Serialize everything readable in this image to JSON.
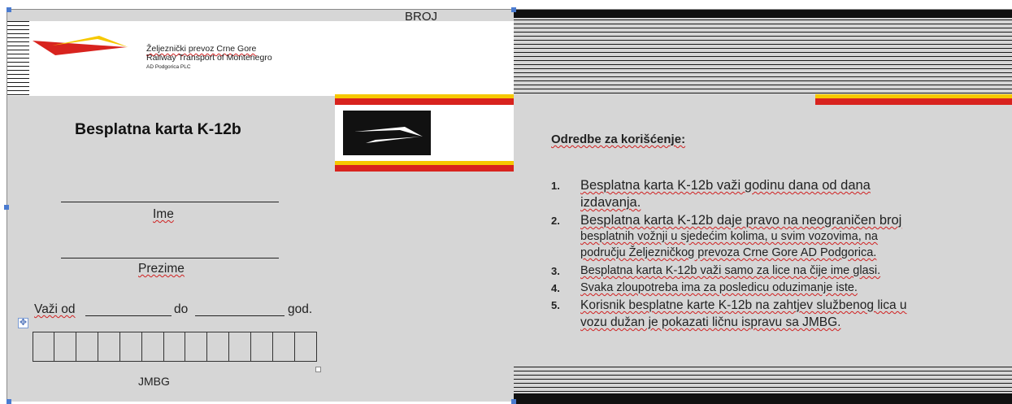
{
  "header": {
    "company_line1": "Željeznički prevoz Crne Gore",
    "company_line2": "Railway Transport of Montenegro",
    "company_line3": "AD Podgorica  PLC",
    "broj": "BROJ"
  },
  "card": {
    "title": "Besplatna karta  K-12b",
    "ime_label": "Ime",
    "prezime_label": "Prezime",
    "vazi_od": "Važi od",
    "do": "do",
    "god": "god.",
    "jmbg_label": "JMBG"
  },
  "rules": {
    "heading": "Odredbe  za  korišćenje:",
    "items": [
      {
        "num": "1.",
        "lines": [
          "Besplatna karta K-12b važi godinu dana od dana",
          "izdavanja."
        ]
      },
      {
        "num": "2.",
        "lines": [
          "Besplatna karta K-12b daje pravo na neograničen broj",
          "besplatnih vožnji u sjedećim kolima, u svim vozovima, na",
          "području  Željezničkog prevoza Crne  Gore AD Podgorica."
        ]
      },
      {
        "num": "3.",
        "lines": [
          "Besplatna karta K-12b važi samo za lice na čije ime glasi."
        ]
      },
      {
        "num": "4.",
        "lines": [
          "Svaka zloupotreba ima za posledicu oduzimanje iste."
        ]
      },
      {
        "num": "5.",
        "lines": [
          "Korisnik besplatne karte K-12b na zahtjev  službenog lica u",
          "vozu  dužan je pokazati ličnu ispravu sa JMBG."
        ]
      }
    ]
  },
  "colors": {
    "yellow": "#f6c800",
    "red": "#d8231e",
    "gray": "#d6d6d6"
  }
}
